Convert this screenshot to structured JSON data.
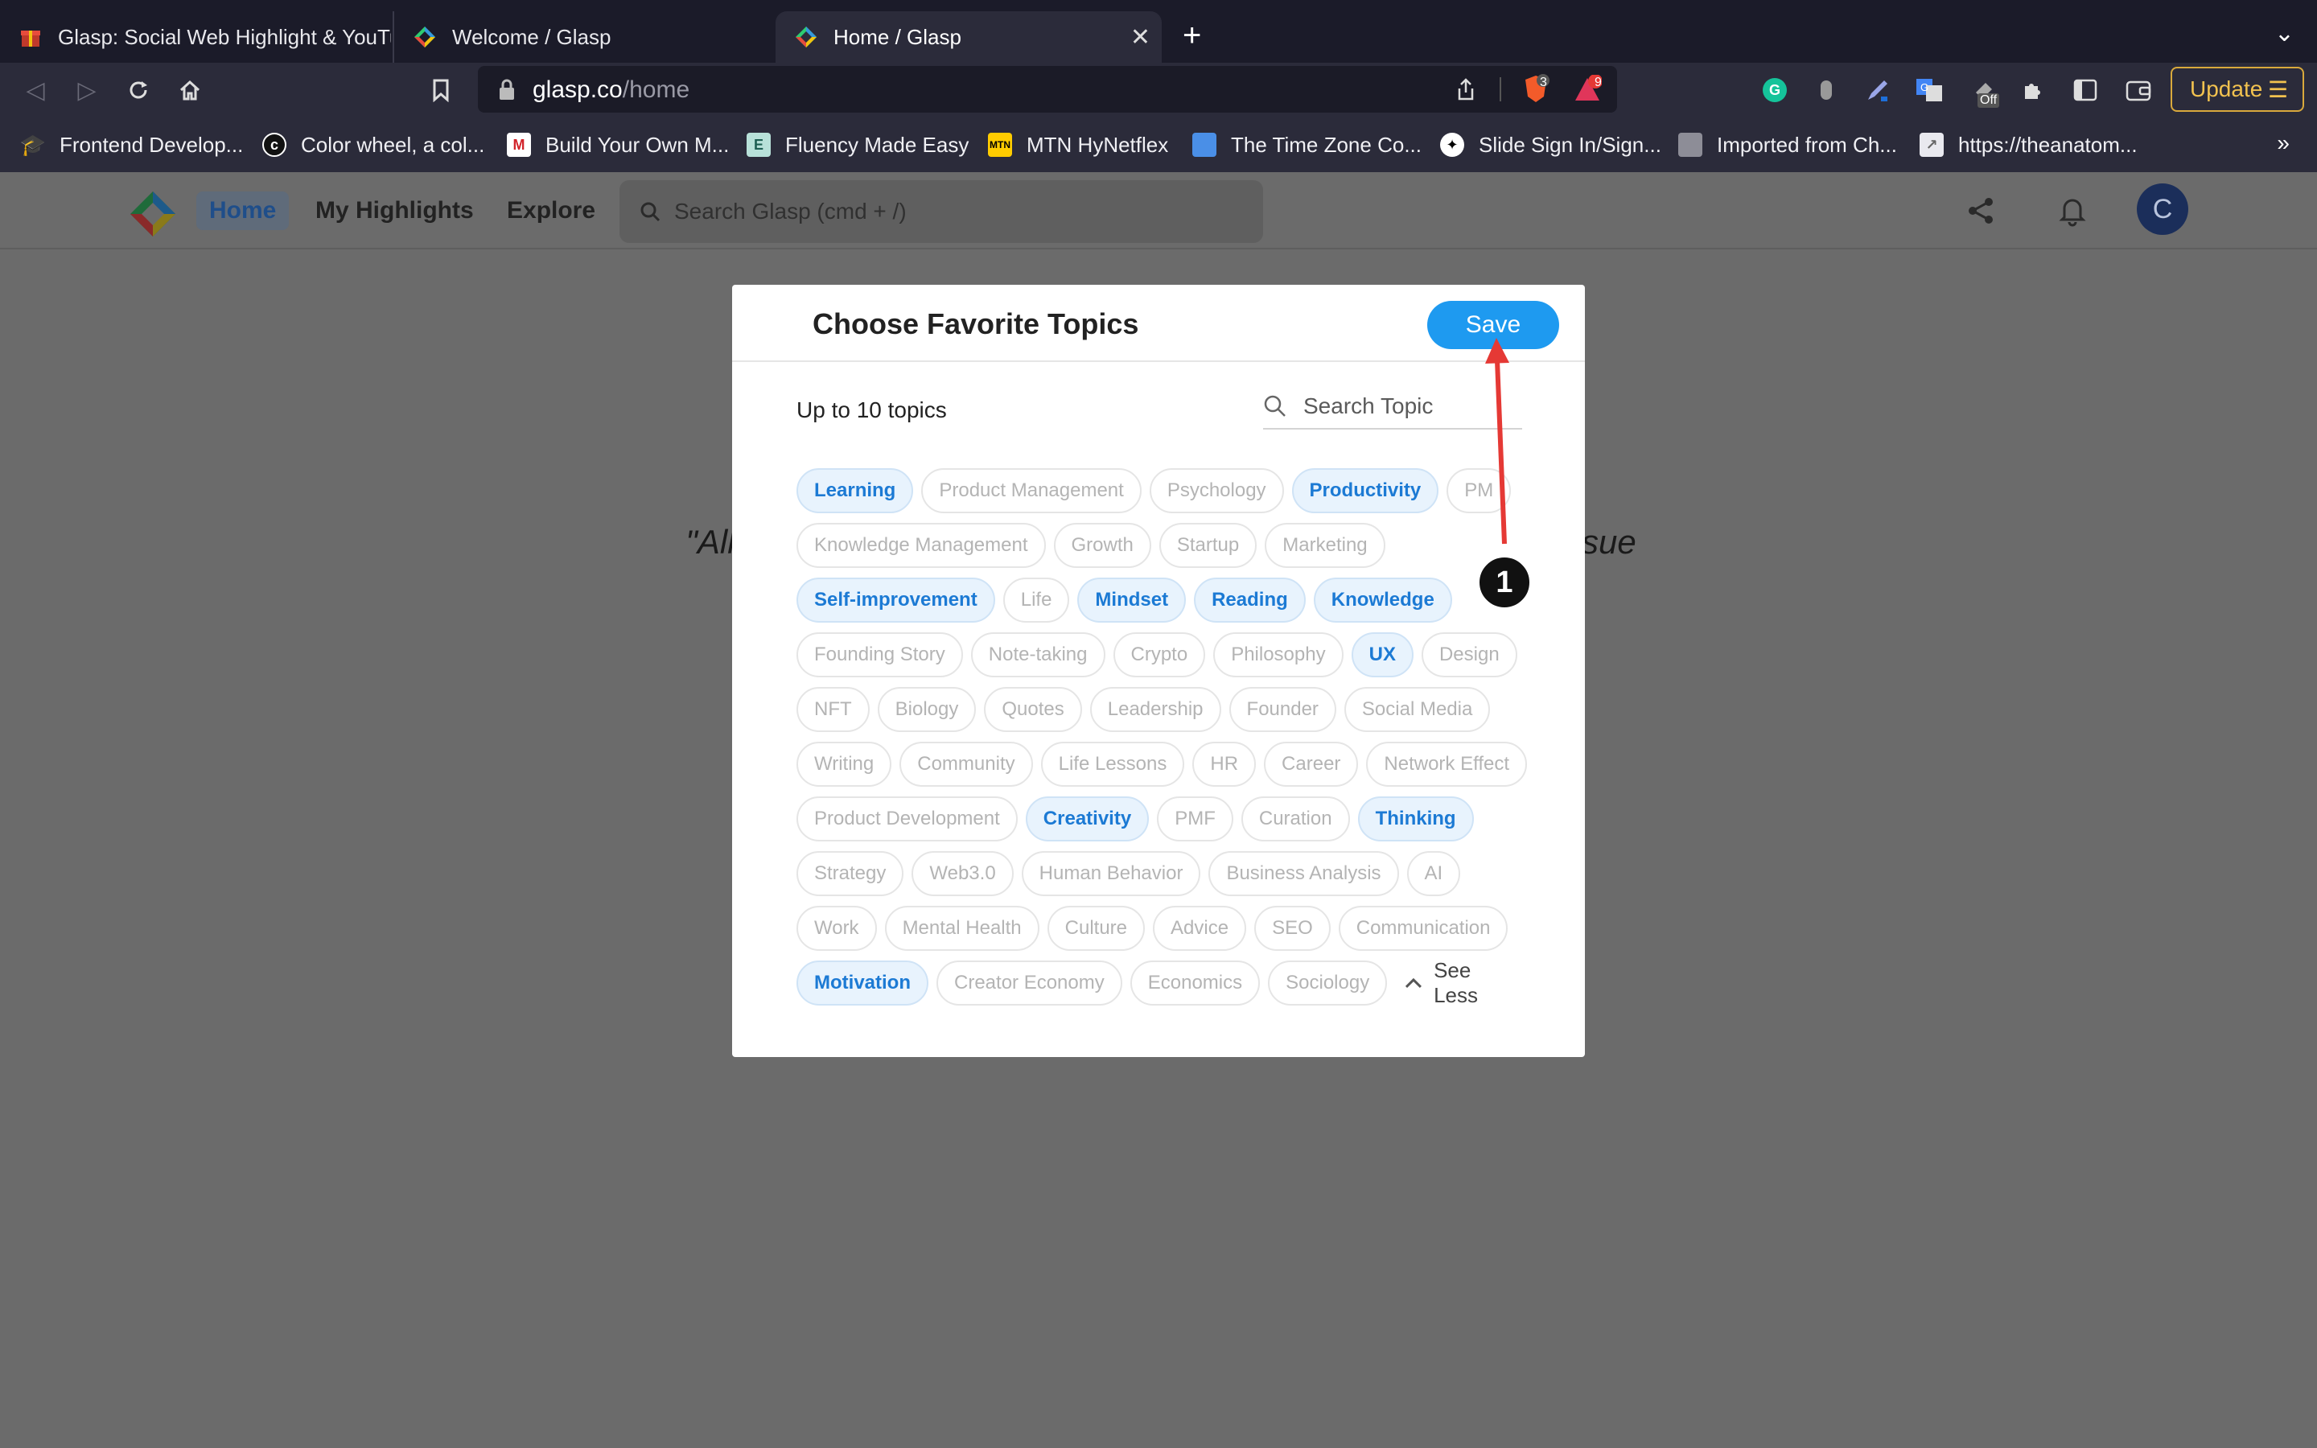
{
  "browser": {
    "tabs": [
      {
        "title": "Glasp: Social Web Highlight & YouTu",
        "icon": "gift-favicon"
      },
      {
        "title": "Welcome / Glasp",
        "icon": "glasp-favicon"
      },
      {
        "title": "Home / Glasp",
        "icon": "glasp-favicon",
        "active": true
      }
    ],
    "url_host": "glasp.co",
    "url_path": "/home",
    "brave_badge": "3",
    "rewards_badge": "9",
    "ext_off_label": "Off",
    "update_label": "Update",
    "bookmarks": [
      {
        "label": "Frontend Develop..."
      },
      {
        "label": "Color wheel, a col..."
      },
      {
        "label": "Build Your Own M..."
      },
      {
        "label": "Fluency Made Easy"
      },
      {
        "label": "MTN HyNetflex"
      },
      {
        "label": "The Time Zone Co..."
      },
      {
        "label": "Slide Sign In/Sign..."
      },
      {
        "label": "Imported from Ch..."
      },
      {
        "label": "https://theanatom..."
      }
    ],
    "bookmarks_more": "»"
  },
  "site": {
    "nav": {
      "home": "Home",
      "highlights": "My Highlights",
      "explore": "Explore"
    },
    "search_placeholder": "Search Glasp (cmd + /)",
    "avatar_initial": "C",
    "quote_left": "\"All",
    "quote_right": "sue"
  },
  "modal": {
    "title": "Choose Favorite Topics",
    "save_label": "Save",
    "limit_text": "Up to 10 topics",
    "search_placeholder": "Search Topic",
    "see_less_label": "See Less",
    "topic_rows": [
      [
        {
          "label": "Learning",
          "selected": true
        },
        {
          "label": "Product Management"
        },
        {
          "label": "Psychology"
        },
        {
          "label": "Productivity",
          "selected": true
        },
        {
          "label": "PM"
        }
      ],
      [
        {
          "label": "Knowledge Management"
        },
        {
          "label": "Growth"
        },
        {
          "label": "Startup"
        },
        {
          "label": "Marketing"
        }
      ],
      [
        {
          "label": "Self-improvement",
          "selected": true
        },
        {
          "label": "Life"
        },
        {
          "label": "Mindset",
          "selected": true
        },
        {
          "label": "Reading",
          "selected": true
        },
        {
          "label": "Knowledge",
          "selected": true
        }
      ],
      [
        {
          "label": "Founding Story"
        },
        {
          "label": "Note-taking"
        },
        {
          "label": "Crypto"
        },
        {
          "label": "Philosophy"
        },
        {
          "label": "UX",
          "selected": true
        },
        {
          "label": "Design"
        }
      ],
      [
        {
          "label": "NFT"
        },
        {
          "label": "Biology"
        },
        {
          "label": "Quotes"
        },
        {
          "label": "Leadership"
        },
        {
          "label": "Founder"
        },
        {
          "label": "Social Media"
        }
      ],
      [
        {
          "label": "Writing"
        },
        {
          "label": "Community"
        },
        {
          "label": "Life Lessons"
        },
        {
          "label": "HR"
        },
        {
          "label": "Career"
        },
        {
          "label": "Network Effect"
        }
      ],
      [
        {
          "label": "Product Development"
        },
        {
          "label": "Creativity",
          "selected": true
        },
        {
          "label": "PMF"
        },
        {
          "label": "Curation"
        },
        {
          "label": "Thinking",
          "selected": true
        }
      ],
      [
        {
          "label": "Strategy"
        },
        {
          "label": "Web3.0"
        },
        {
          "label": "Human Behavior"
        },
        {
          "label": "Business Analysis"
        },
        {
          "label": "AI"
        }
      ],
      [
        {
          "label": "Work"
        },
        {
          "label": "Mental Health"
        },
        {
          "label": "Culture"
        },
        {
          "label": "Advice"
        },
        {
          "label": "SEO"
        },
        {
          "label": "Communication"
        }
      ],
      [
        {
          "label": "Motivation",
          "selected": true
        },
        {
          "label": "Creator Economy"
        },
        {
          "label": "Economics"
        },
        {
          "label": "Sociology"
        }
      ]
    ]
  },
  "annotation": {
    "step_number": "1",
    "arrow_color": "#e53935"
  },
  "colors": {
    "accent": "#1e9af0",
    "selected_chip_bg": "#e8f3fd",
    "selected_chip_text": "#1c7ad4",
    "update_border": "#d9a93c"
  }
}
